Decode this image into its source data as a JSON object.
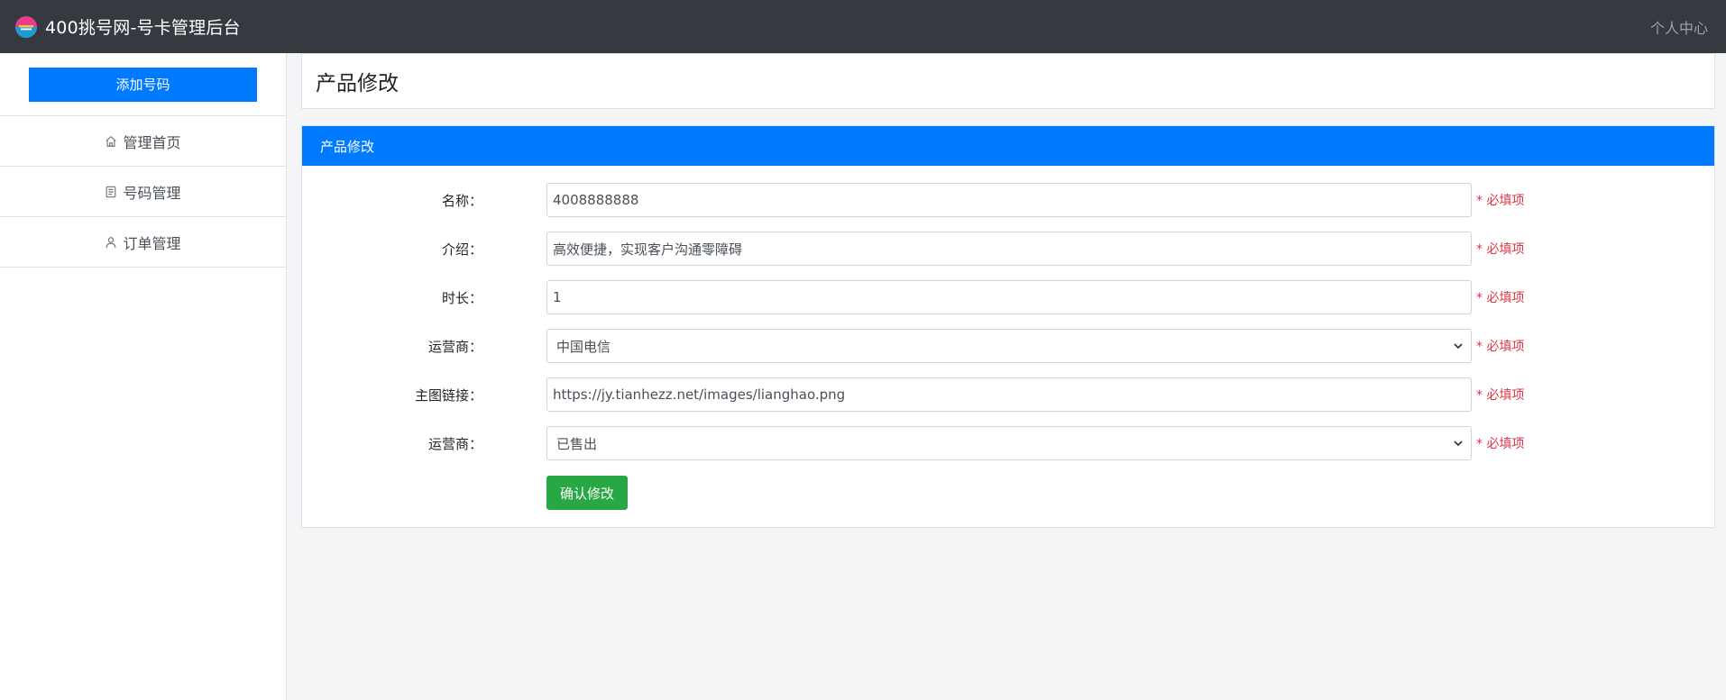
{
  "navbar": {
    "title": "400挑号网-号卡管理后台",
    "user_link": "个人中心",
    "logo_icon": "logo-icon"
  },
  "sidebar": {
    "add_button": "添加号码",
    "items": [
      {
        "label": "管理首页",
        "icon": "home-icon"
      },
      {
        "label": "号码管理",
        "icon": "document-icon"
      },
      {
        "label": "订单管理",
        "icon": "user-icon"
      }
    ]
  },
  "page": {
    "title": "产品修改"
  },
  "card": {
    "title": "产品修改",
    "required_text": "* 必填项",
    "fields": [
      {
        "label": "名称：",
        "value": "4008888888",
        "type": "text"
      },
      {
        "label": "介绍：",
        "value": "高效便捷，实现客户沟通零障碍",
        "type": "text"
      },
      {
        "label": "时长：",
        "value": "1",
        "type": "text"
      },
      {
        "label": "运营商：",
        "value": "中国电信",
        "type": "select"
      },
      {
        "label": "主图链接：",
        "value": "https://jy.tianhezz.net/images/lianghao.png",
        "type": "text"
      },
      {
        "label": "运营商：",
        "value": "已售出",
        "type": "select"
      }
    ],
    "submit_button": "确认修改"
  },
  "colors": {
    "navbar": "#343a40",
    "primary": "#007bff",
    "success": "#28a745",
    "danger": "#dc3545"
  }
}
